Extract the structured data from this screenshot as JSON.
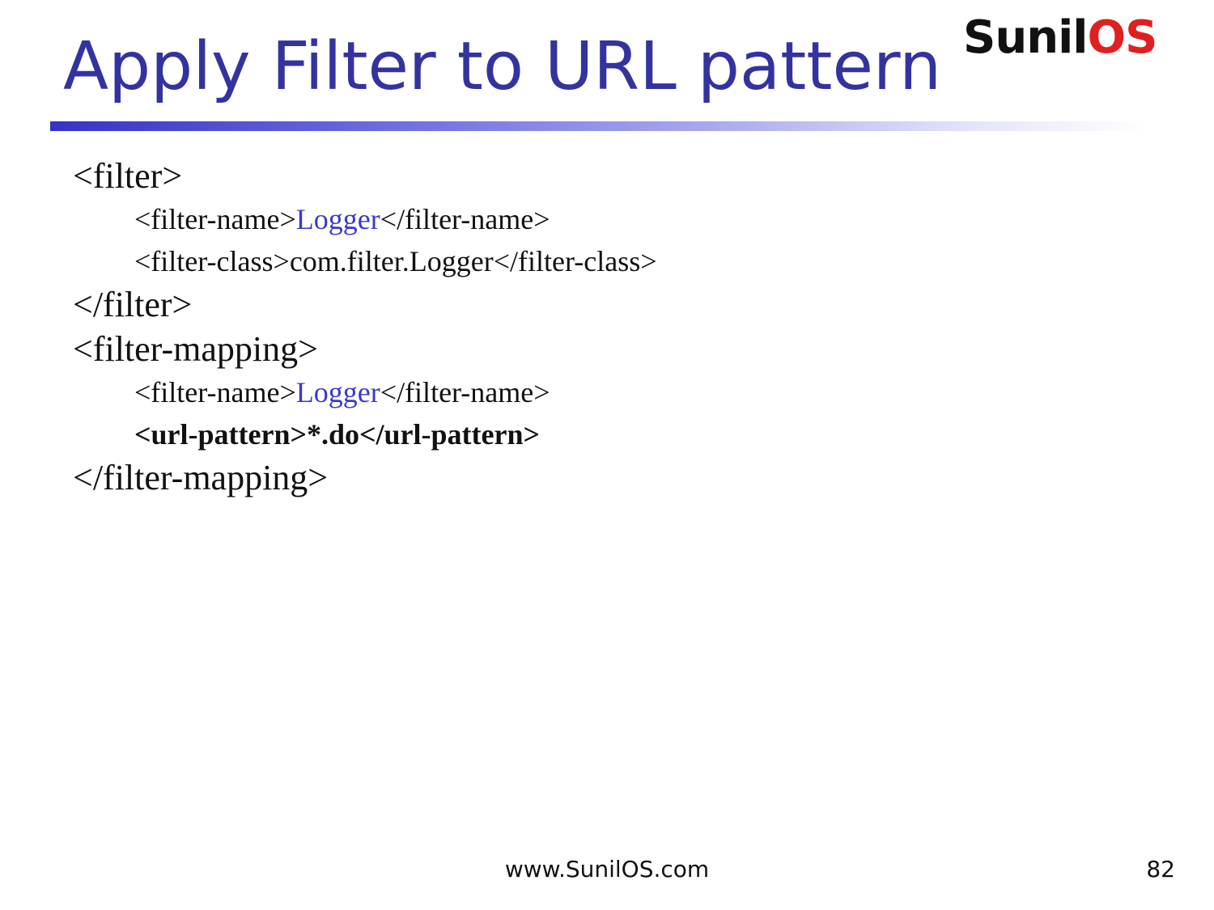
{
  "slide": {
    "title": "Apply Filter to URL pattern",
    "logo": {
      "part1": "Sunil",
      "part2": "OS"
    },
    "code_lines": {
      "l1": "<filter>",
      "l2_pre": "<filter-name>",
      "l2_hl": "Logger",
      "l2_post": "</filter-name>",
      "l3": "<filter-class>com.filter.Logger</filter-class>",
      "l4": "</filter>",
      "l5": "<filter-mapping>",
      "l6_pre": "<filter-name>",
      "l6_hl": "Logger",
      "l6_post": "</filter-name>",
      "l7": "<url-pattern>*.do</url-pattern>",
      "l8": "</filter-mapping>"
    },
    "footer": {
      "url": "www.SunilOS.com",
      "page_number": "82"
    },
    "colors": {
      "title": "#3333a0",
      "highlight": "#3a3ac8",
      "logo_accent": "#e02020"
    }
  }
}
